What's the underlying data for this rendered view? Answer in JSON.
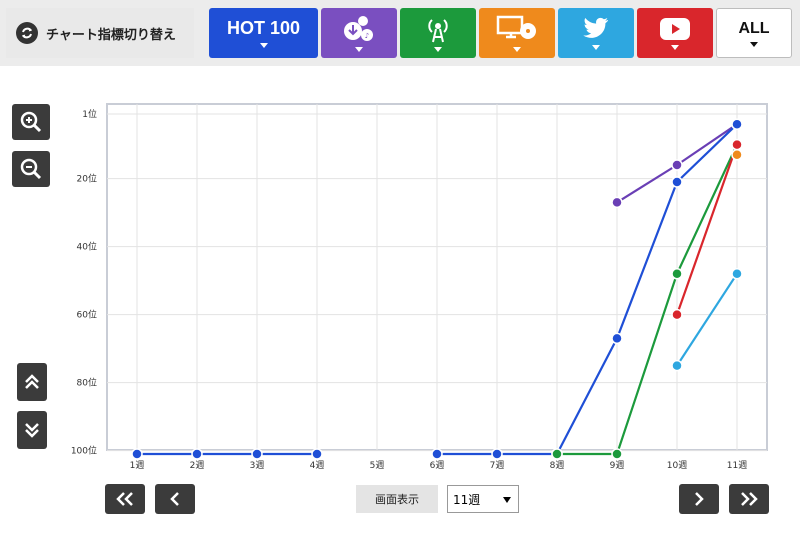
{
  "switcher": {
    "label": "チャート指標切り替え",
    "icon": "refresh-icon"
  },
  "tabs": [
    {
      "id": "hot100",
      "label": "HOT 100",
      "color": "#1f4fd6"
    },
    {
      "id": "download",
      "label": "",
      "icon": "download-icon",
      "color": "#7a4fc0"
    },
    {
      "id": "radio",
      "label": "",
      "icon": "radio-tower-icon",
      "color": "#1c9a3c"
    },
    {
      "id": "pc-cd",
      "label": "",
      "icon": "monitor-cd-icon",
      "color": "#ef8a1c"
    },
    {
      "id": "twitter",
      "label": "",
      "icon": "twitter-icon",
      "color": "#2ea7e0"
    },
    {
      "id": "youtube",
      "label": "",
      "icon": "youtube-icon",
      "color": "#d9262c"
    },
    {
      "id": "all",
      "label": "ALL",
      "color": "#ffffff"
    }
  ],
  "chart_data": {
    "type": "line",
    "x": [
      "1週",
      "2週",
      "3週",
      "4週",
      "5週",
      "6週",
      "7週",
      "8週",
      "9週",
      "10週",
      "11週"
    ],
    "y_ticks": [
      {
        "v": 1,
        "label": "1位"
      },
      {
        "v": 20,
        "label": "20位"
      },
      {
        "v": 40,
        "label": "40位"
      },
      {
        "v": 60,
        "label": "60位"
      },
      {
        "v": 80,
        "label": "80位"
      },
      {
        "v": 100,
        "label": "100位"
      }
    ],
    "ylim": [
      1,
      100
    ],
    "y_inverted": true,
    "grid": true,
    "series": [
      {
        "color": "#6a3fb5",
        "values": [
          null,
          null,
          null,
          null,
          null,
          null,
          null,
          null,
          27,
          16,
          4
        ]
      },
      {
        "color": "#1f4fd6",
        "values": [
          101,
          101,
          101,
          101,
          null,
          101,
          101,
          101,
          67,
          21,
          4
        ]
      },
      {
        "color": "#1c9a3c",
        "values": [
          null,
          null,
          null,
          null,
          null,
          null,
          null,
          101,
          101,
          48,
          10
        ]
      },
      {
        "color": "#d9262c",
        "values": [
          null,
          null,
          null,
          null,
          null,
          null,
          null,
          null,
          null,
          60,
          10
        ]
      },
      {
        "color": "#2ea7e0",
        "values": [
          null,
          null,
          null,
          null,
          null,
          null,
          null,
          null,
          null,
          75,
          48
        ]
      },
      {
        "color": "#ef8a1c",
        "values": [
          null,
          null,
          null,
          null,
          null,
          null,
          null,
          null,
          null,
          null,
          13
        ]
      }
    ]
  },
  "controls": {
    "display_label": "画面表示",
    "weeks_value": "11週",
    "zoom_in_icon": "zoom-in-icon",
    "zoom_out_icon": "zoom-out-icon"
  }
}
